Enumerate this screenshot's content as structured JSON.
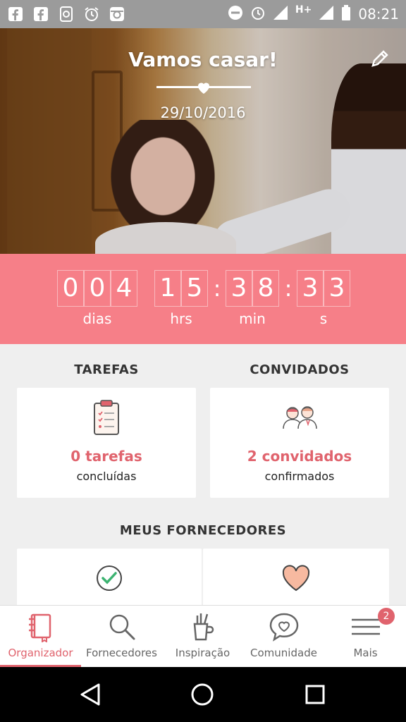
{
  "status_bar": {
    "left_icons": [
      "facebook-icon",
      "facebook-icon",
      "whatsapp-icon",
      "alarm-icon",
      "instagram-icon"
    ],
    "right_icons": [
      "do-not-disturb-icon",
      "alarm-icon",
      "signal-icon",
      "h-plus-icon",
      "signal-icon",
      "battery-icon"
    ],
    "network": "H+",
    "time": "08:21"
  },
  "hero": {
    "title": "Vamos casar!",
    "date": "29/10/2016"
  },
  "countdown": {
    "days": [
      "0",
      "0",
      "4"
    ],
    "hours": [
      "1",
      "5"
    ],
    "minutes": [
      "3",
      "8"
    ],
    "seconds": [
      "3",
      "3"
    ],
    "colon": ":",
    "labels": {
      "days": "dias",
      "hours": "hrs",
      "minutes": "min",
      "seconds": "s"
    }
  },
  "tasks": {
    "title": "TAREFAS",
    "value": "0 tarefas",
    "label": "concluídas"
  },
  "guests": {
    "title": "CONVIDADOS",
    "value": "2 convidados",
    "label": "confirmados"
  },
  "vendors": {
    "title": "MEUS FORNECEDORES"
  },
  "bottom_nav": {
    "items": [
      {
        "label": "Organizador",
        "icon": "notebook-icon",
        "active": true
      },
      {
        "label": "Fornecedores",
        "icon": "search-icon",
        "active": false
      },
      {
        "label": "Inspiração",
        "icon": "pencil-cup-icon",
        "active": false
      },
      {
        "label": "Comunidade",
        "icon": "chat-heart-icon",
        "active": false
      },
      {
        "label": "Mais",
        "icon": "menu-icon",
        "active": false
      }
    ],
    "badge": "2"
  },
  "colors": {
    "accent": "#e0636d",
    "countdown_bg": "#f67f88",
    "page_bg": "#efefef"
  }
}
